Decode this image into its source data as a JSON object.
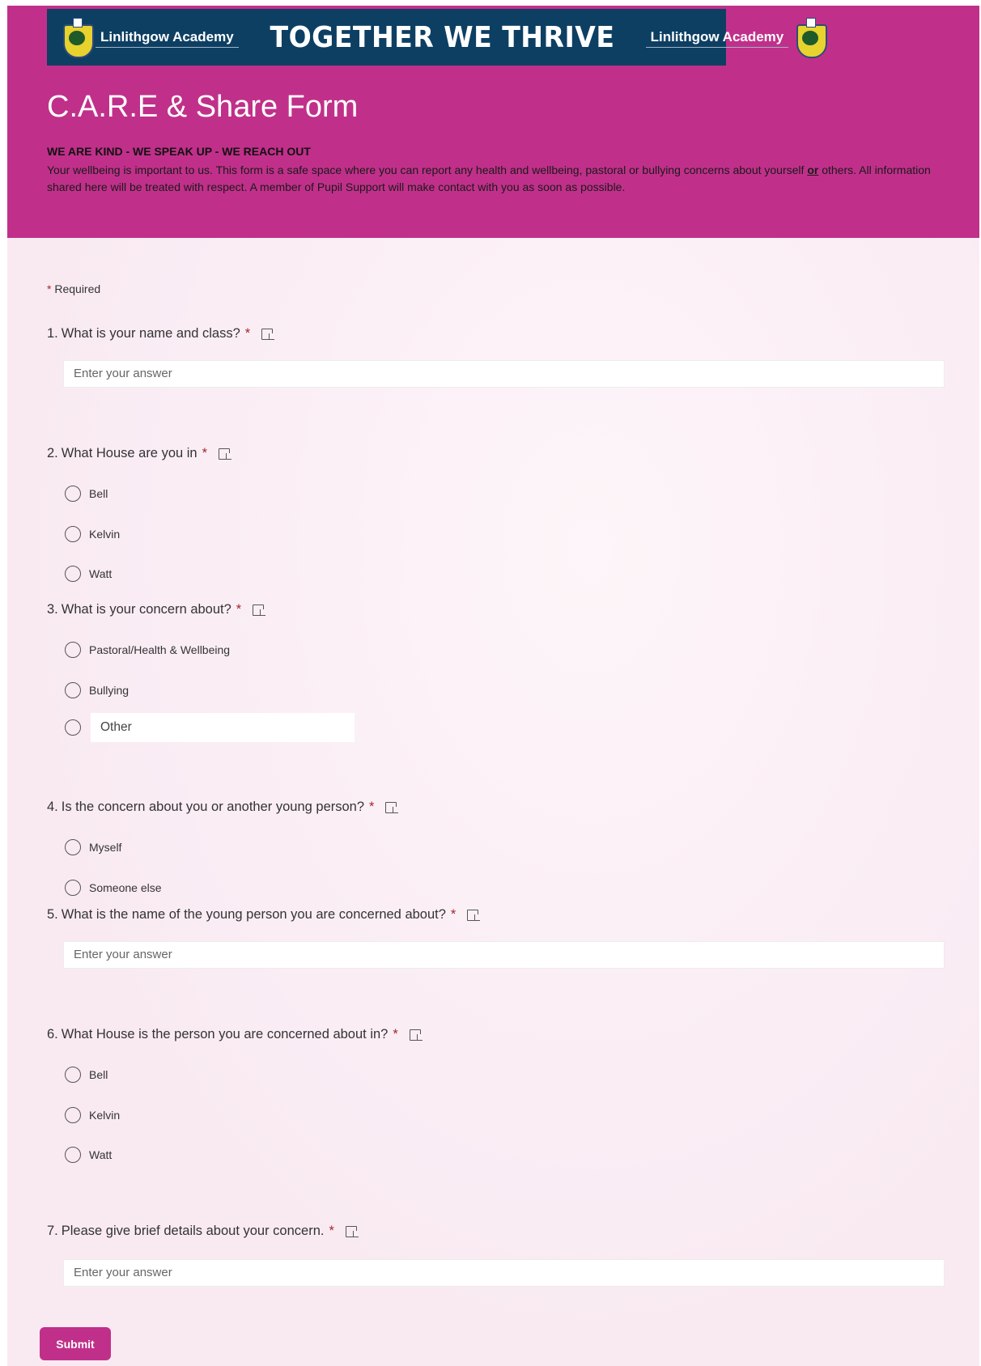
{
  "banner": {
    "school_name_left": "Linlithgow Academy",
    "motto": "TOGETHER WE THRIVE",
    "school_name_right": "Linlithgow Academy"
  },
  "form": {
    "title": "C.A.R.E & Share Form",
    "slogan": "WE ARE KIND - WE SPEAK UP - WE REACH OUT",
    "intro_part1": "Your wellbeing is important to us. This form is a safe space where you can report any health and wellbeing, pastoral or bullying concerns  about yourself ",
    "intro_emphasis": "or",
    "intro_part2": " others. All information shared here will be treated with respect.  A member of Pupil Support will make contact with you as soon as possible.",
    "required_star": "*",
    "required_label": "Required",
    "submit_label": "Submit"
  },
  "questions": [
    {
      "number": "1.",
      "title": "What is your name and class?",
      "star": "*",
      "placeholder": "Enter your answer"
    },
    {
      "number": "2.",
      "title": "What House are you in",
      "star": "*",
      "options": [
        "Bell",
        "Kelvin",
        "Watt"
      ]
    },
    {
      "number": "3.",
      "title": "What is your concern about?",
      "star": "*",
      "options": [
        "Pastoral/Health & Wellbeing",
        "Bullying"
      ],
      "other_label": "Other"
    },
    {
      "number": "4.",
      "title": "Is the concern about you or another young person?",
      "star": "*",
      "options": [
        "Myself",
        "Someone else"
      ]
    },
    {
      "number": "5.",
      "title": "What is the name of the young person you are concerned about?",
      "star": "*",
      "placeholder": "Enter your answer"
    },
    {
      "number": "6.",
      "title": "What House is the person you are concerned about in?",
      "star": "*",
      "options": [
        "Bell",
        "Kelvin",
        "Watt"
      ]
    },
    {
      "number": "7.",
      "title": "Please give brief details about your concern.",
      "star": "*",
      "placeholder": "Enter your answer"
    }
  ],
  "colors": {
    "header_bg": "#c0308a",
    "banner_bg": "#0d3f63",
    "required_star": "#a4262c",
    "page_bg": "#faf0f5"
  },
  "icons": {
    "immersive_reader": "immersive-reader-icon",
    "school_crest": "school-crest-icon"
  }
}
